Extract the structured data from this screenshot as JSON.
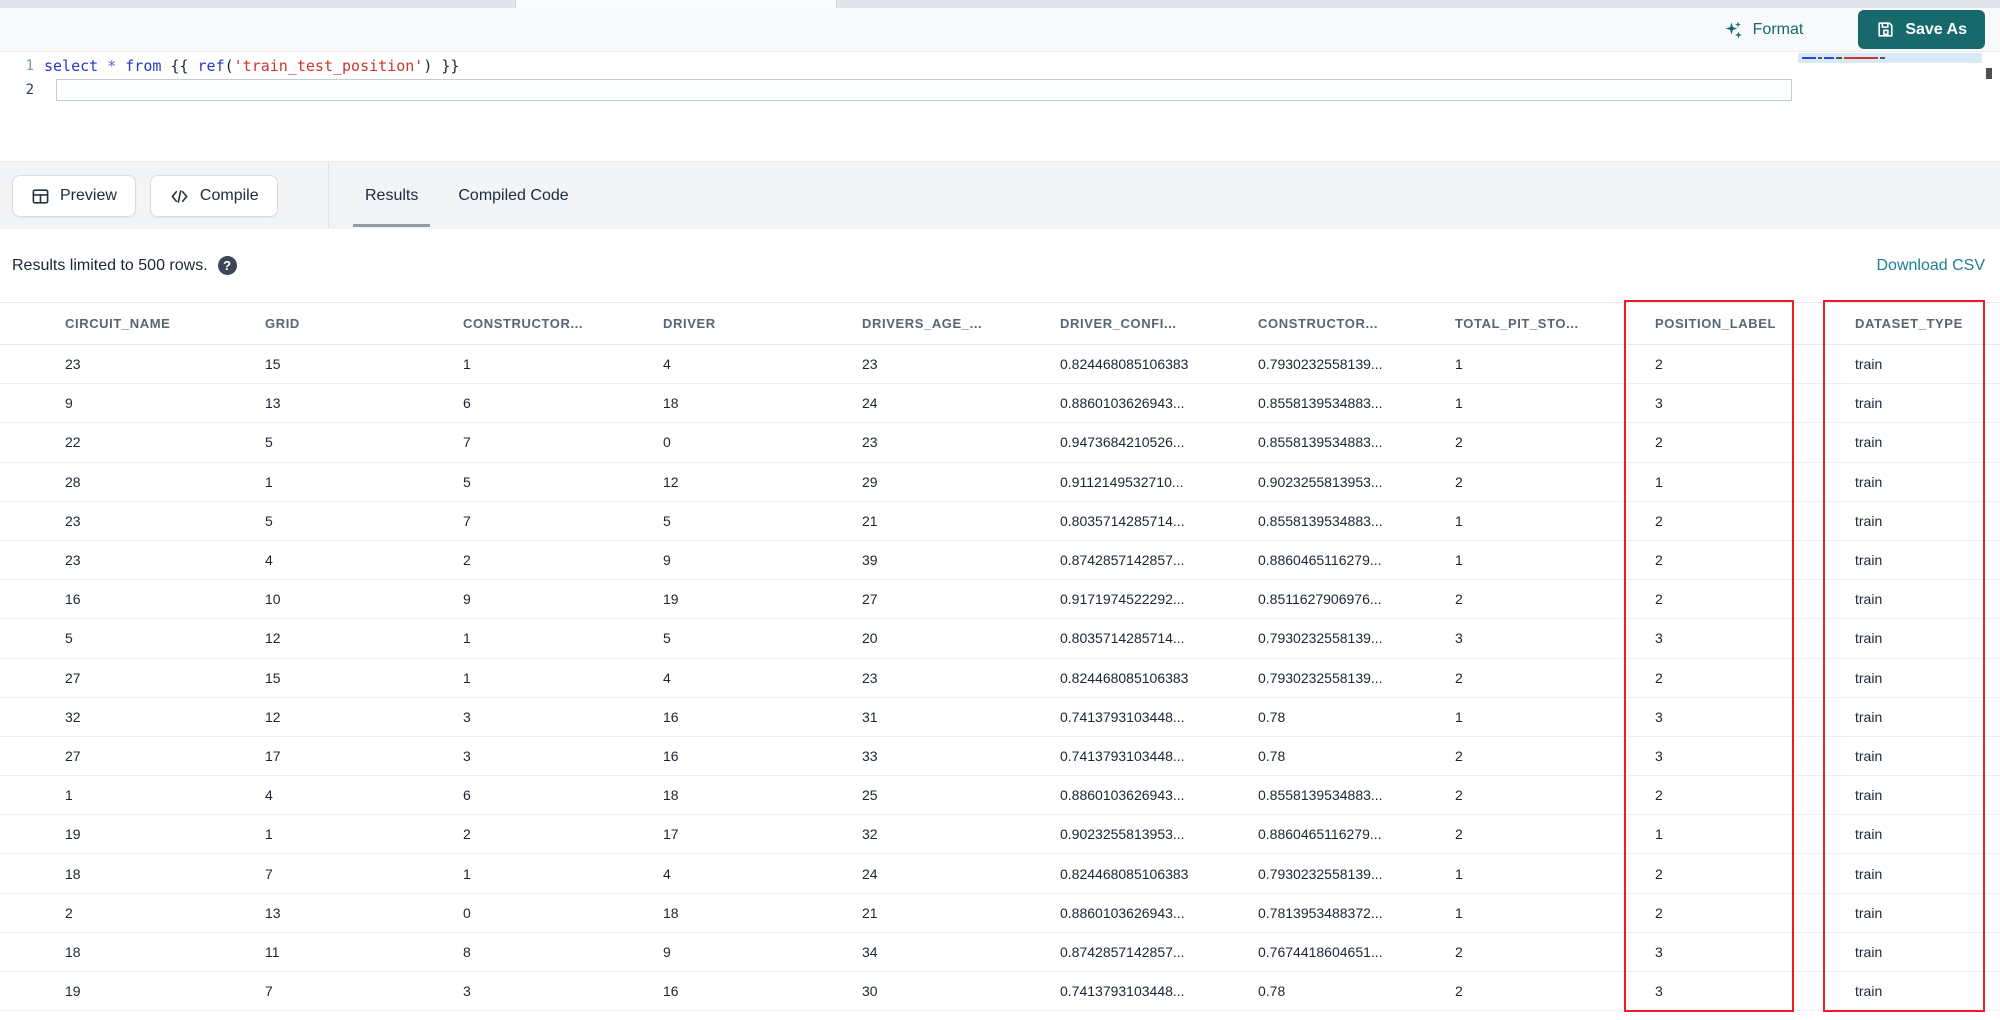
{
  "header_bar": {
    "format_label": "Format",
    "save_as_label": "Save As"
  },
  "editor": {
    "line1_number": "1",
    "line2_number": "2",
    "code": {
      "kw_select": "select",
      "star": "*",
      "kw_from": "from",
      "jinja_open": "{{ ",
      "fn_ref": "ref",
      "paren_open": "(",
      "string": "'train_test_position'",
      "paren_close": ")",
      "jinja_close": " }}"
    }
  },
  "toolbar": {
    "preview_label": "Preview",
    "compile_label": "Compile",
    "tabs": [
      {
        "label": "Results",
        "active": true
      },
      {
        "label": "Compiled Code",
        "active": false
      }
    ]
  },
  "results_bar": {
    "info": "Results limited to 500 rows.",
    "help_glyph": "?",
    "download_label": "Download CSV"
  },
  "table": {
    "columns": [
      "CIRCUIT_NAME",
      "GRID",
      "CONSTRUCTOR...",
      "DRIVER",
      "DRIVERS_AGE_...",
      "DRIVER_CONFI...",
      "CONSTRUCTOR...",
      "TOTAL_PIT_STO...",
      "POSITION_LABEL",
      "DATASET_TYPE"
    ],
    "highlighted_columns": [
      "POSITION_LABEL",
      "DATASET_TYPE"
    ],
    "highlight_color": "#ed1c24",
    "rows": [
      [
        "23",
        "15",
        "1",
        "4",
        "23",
        "0.824468085106383",
        "0.7930232558139...",
        "1",
        "2",
        "train"
      ],
      [
        "9",
        "13",
        "6",
        "18",
        "24",
        "0.8860103626943...",
        "0.8558139534883...",
        "1",
        "3",
        "train"
      ],
      [
        "22",
        "5",
        "7",
        "0",
        "23",
        "0.9473684210526...",
        "0.8558139534883...",
        "2",
        "2",
        "train"
      ],
      [
        "28",
        "1",
        "5",
        "12",
        "29",
        "0.9112149532710...",
        "0.9023255813953...",
        "2",
        "1",
        "train"
      ],
      [
        "23",
        "5",
        "7",
        "5",
        "21",
        "0.8035714285714...",
        "0.8558139534883...",
        "1",
        "2",
        "train"
      ],
      [
        "23",
        "4",
        "2",
        "9",
        "39",
        "0.8742857142857...",
        "0.8860465116279...",
        "1",
        "2",
        "train"
      ],
      [
        "16",
        "10",
        "9",
        "19",
        "27",
        "0.9171974522292...",
        "0.8511627906976...",
        "2",
        "2",
        "train"
      ],
      [
        "5",
        "12",
        "1",
        "5",
        "20",
        "0.8035714285714...",
        "0.7930232558139...",
        "3",
        "3",
        "train"
      ],
      [
        "27",
        "15",
        "1",
        "4",
        "23",
        "0.824468085106383",
        "0.7930232558139...",
        "2",
        "2",
        "train"
      ],
      [
        "32",
        "12",
        "3",
        "16",
        "31",
        "0.7413793103448...",
        "0.78",
        "1",
        "3",
        "train"
      ],
      [
        "27",
        "17",
        "3",
        "16",
        "33",
        "0.7413793103448...",
        "0.78",
        "2",
        "3",
        "train"
      ],
      [
        "1",
        "4",
        "6",
        "18",
        "25",
        "0.8860103626943...",
        "0.8558139534883...",
        "2",
        "2",
        "train"
      ],
      [
        "19",
        "1",
        "2",
        "17",
        "32",
        "0.9023255813953...",
        "0.8860465116279...",
        "2",
        "1",
        "train"
      ],
      [
        "18",
        "7",
        "1",
        "4",
        "24",
        "0.824468085106383",
        "0.7930232558139...",
        "1",
        "2",
        "train"
      ],
      [
        "2",
        "13",
        "0",
        "18",
        "21",
        "0.8860103626943...",
        "0.7813953488372...",
        "1",
        "2",
        "train"
      ],
      [
        "18",
        "11",
        "8",
        "9",
        "34",
        "0.8742857142857...",
        "0.7674418604651...",
        "2",
        "3",
        "train"
      ],
      [
        "19",
        "7",
        "3",
        "16",
        "30",
        "0.7413793103448...",
        "0.78",
        "2",
        "3",
        "train"
      ]
    ]
  },
  "colors": {
    "accent_teal": "#17696b",
    "link_teal": "#1b7f93",
    "tab_underline": "#959ca6"
  }
}
